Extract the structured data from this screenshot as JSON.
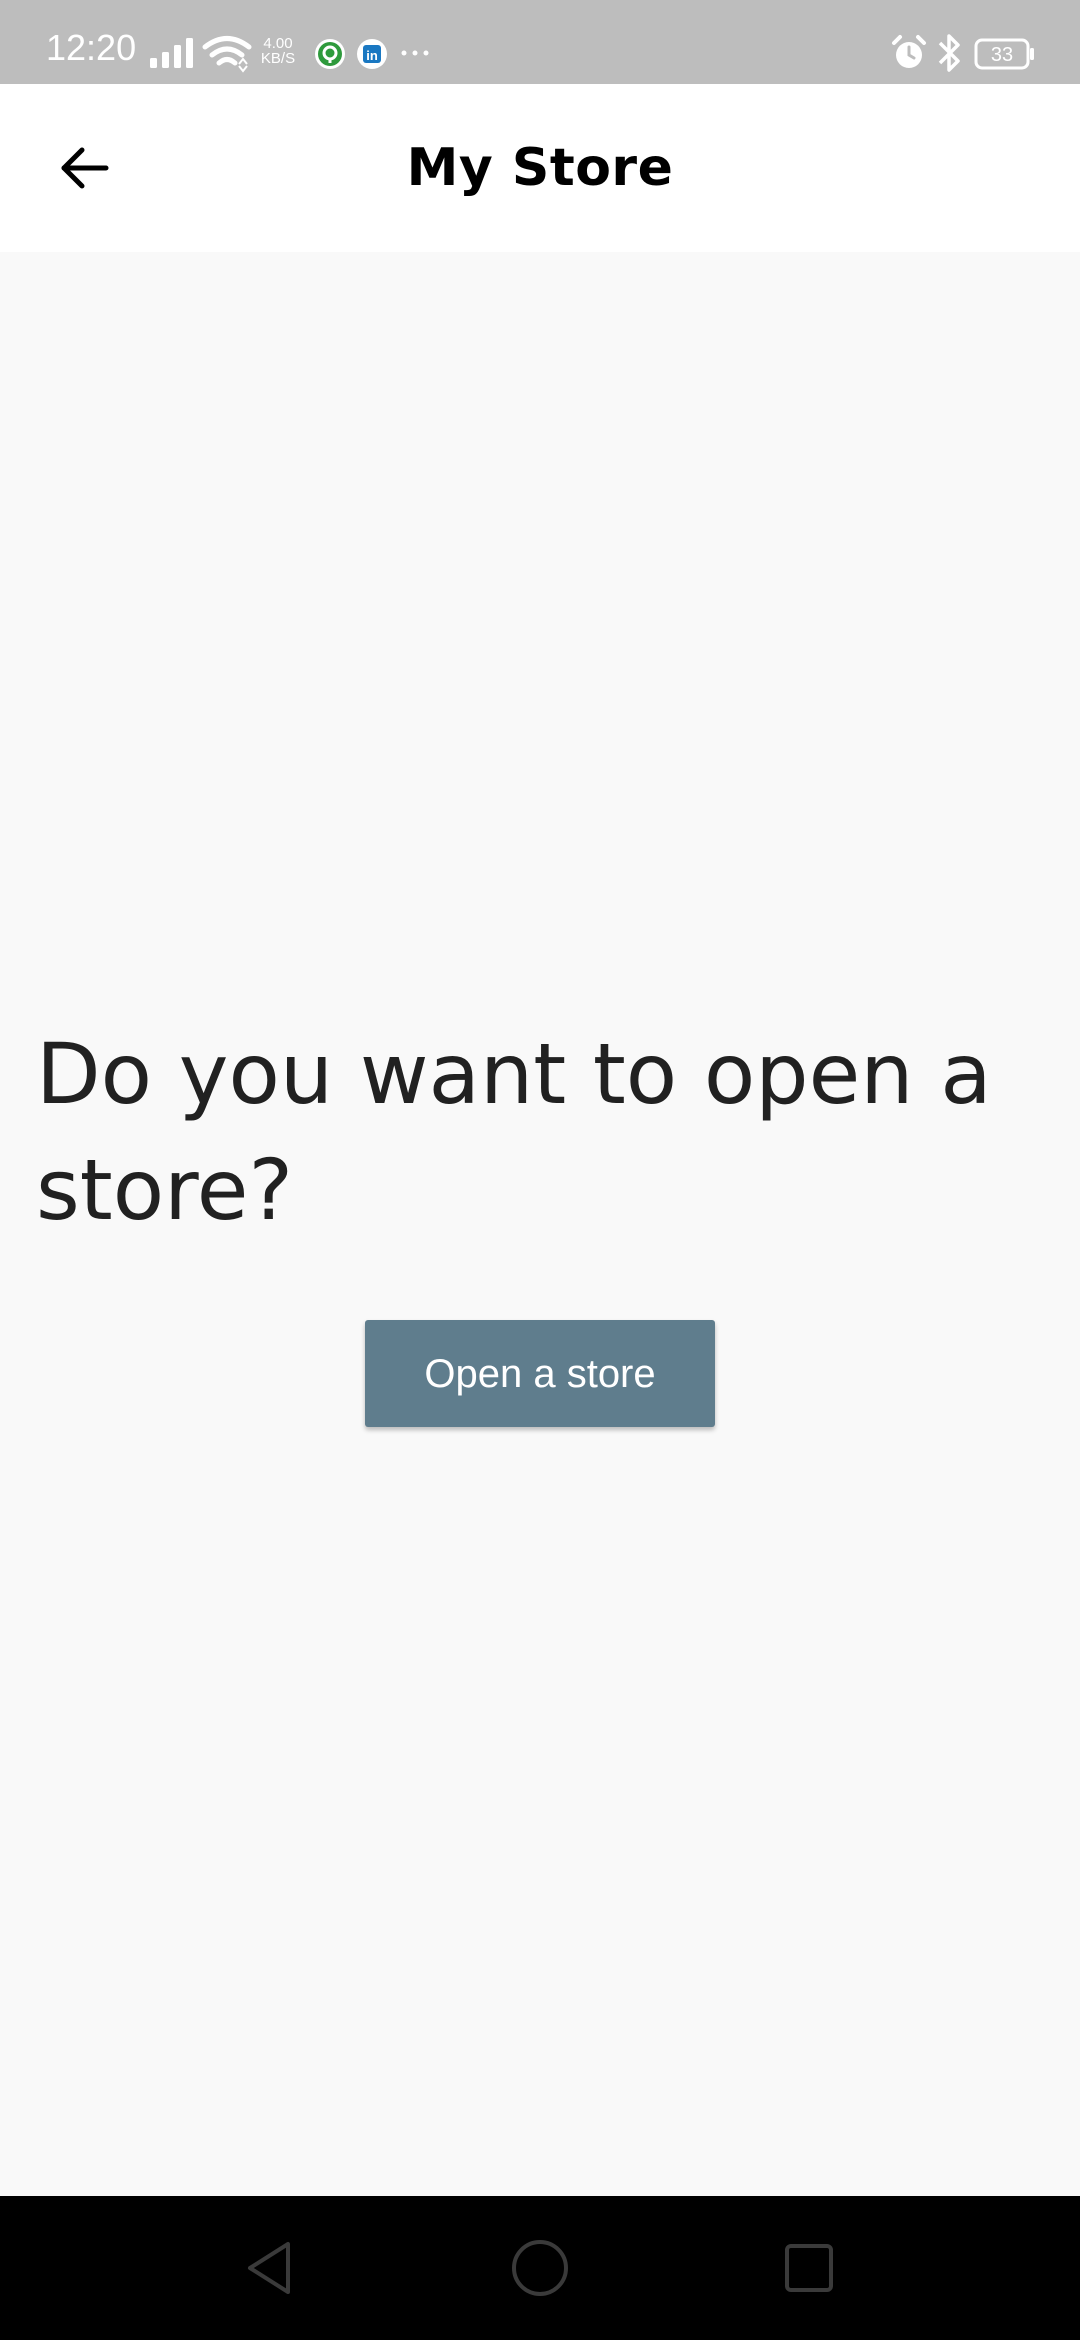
{
  "status_bar": {
    "time": "12:20",
    "net_speed_value": "4.00",
    "net_speed_unit": "KB/S",
    "battery_level": "33",
    "icons": [
      "signal-icon",
      "wifi-icon",
      "app-notification-icon",
      "linkedin-icon",
      "more-icon",
      "alarm-icon",
      "bluetooth-icon",
      "battery-icon"
    ],
    "status_bar_color": "#bdbdbd"
  },
  "app_bar": {
    "title": "My Store",
    "back_icon": "back-arrow-icon"
  },
  "main": {
    "prompt": "Do you want to open a store?",
    "open_store_label": "Open a store",
    "button_color": "#5f7d8d"
  },
  "nav_bar": {
    "buttons": [
      "back-nav-icon",
      "home-nav-icon",
      "recents-nav-icon"
    ]
  }
}
